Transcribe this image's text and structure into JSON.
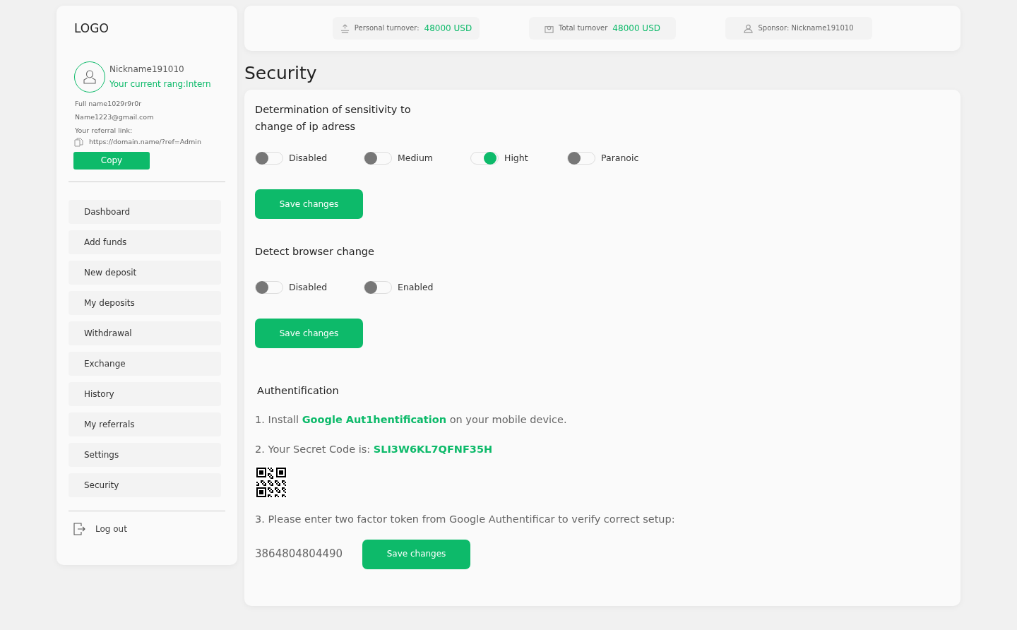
{
  "sidebar": {
    "logo": "LOGO",
    "user": {
      "nickname": "Nickname191010",
      "rank": "Your current rang:Intern",
      "full_name": "Full name1029r9r0r",
      "email": "Name1223@gmail.com",
      "referral_label": "Your referral link:",
      "referral_link": "https://domain.name/?ref=Admin",
      "copy_button": "Copy"
    },
    "menu": [
      {
        "label": "Dashboard",
        "selected": false
      },
      {
        "label": "Add funds",
        "selected": false
      },
      {
        "label": "New deposit",
        "selected": false
      },
      {
        "label": "My deposits",
        "selected": false
      },
      {
        "label": "Withdrawal",
        "selected": false
      },
      {
        "label": "Exchange",
        "selected": false
      },
      {
        "label": "History",
        "selected": false
      },
      {
        "label": "My referrals",
        "selected": false
      },
      {
        "label": "Settings",
        "selected": false
      },
      {
        "label": "Security",
        "selected": false
      }
    ],
    "logout": "Log out"
  },
  "stats": [
    {
      "kind": "personal",
      "label": "Personal turnover:",
      "value": "48000 USD"
    },
    {
      "kind": "total",
      "label": "Total turnover",
      "value": "48000 USD"
    },
    {
      "kind": "sponsor",
      "label": "Sponsor: Nickname191010"
    }
  ],
  "page_title": "Security",
  "ip_sensitivity": {
    "title": "Determination of sensitivity to change of ip adress",
    "options": [
      {
        "label": "Disabled",
        "on": false
      },
      {
        "label": "Medium",
        "on": false
      },
      {
        "label": "Hight",
        "on": true
      },
      {
        "label": "Paranoic",
        "on": false
      }
    ],
    "button": "Save changes"
  },
  "browser_change": {
    "title": "Detect browser change",
    "options": [
      {
        "label": "Disabled",
        "on": false
      },
      {
        "label": "Enabled",
        "on": false
      }
    ],
    "button": "Save changes"
  },
  "authentication": {
    "title": "Authentification",
    "step_1": "1. Install **Google Aut1hentification** on your mobile device.",
    "step_2": "2. Your Secret Code is: **SLI3W6KL7QFNF35H**",
    "step_3": "3. Please enter two factor token from Google Authentificar to verify correct setup:",
    "token": "3864804804490",
    "button": "Save changes"
  }
}
